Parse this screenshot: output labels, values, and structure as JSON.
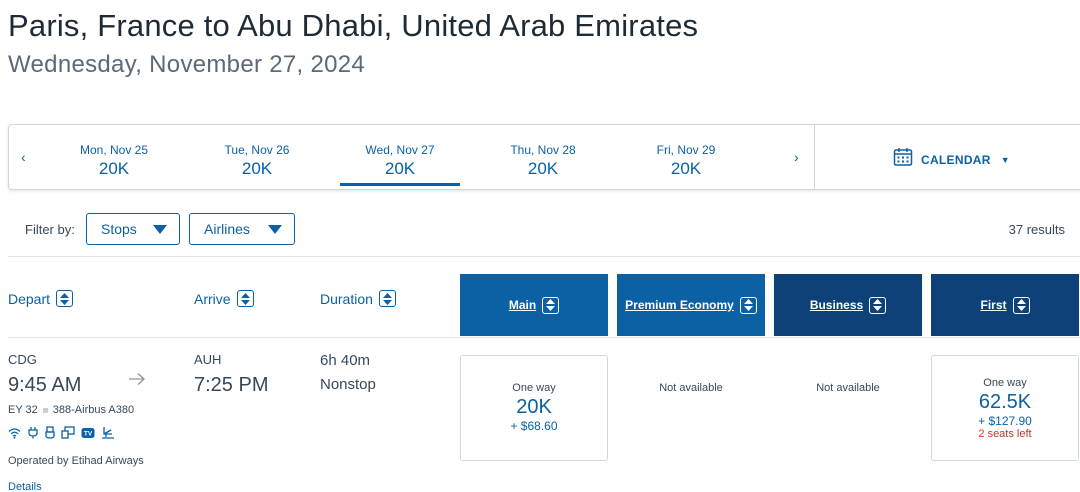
{
  "header": {
    "title": "Paris, France to Abu Dhabi, United Arab Emirates",
    "subtitle": "Wednesday, November 27, 2024"
  },
  "date_strip": {
    "prev_label": "‹",
    "next_label": "›",
    "days": [
      {
        "label": "Mon, Nov 25",
        "value": "20K",
        "selected": false
      },
      {
        "label": "Tue, Nov 26",
        "value": "20K",
        "selected": false
      },
      {
        "label": "Wed, Nov 27",
        "value": "20K",
        "selected": true
      },
      {
        "label": "Thu, Nov 28",
        "value": "20K",
        "selected": false
      },
      {
        "label": "Fri, Nov 29",
        "value": "20K",
        "selected": false
      }
    ],
    "calendar_label": "CALENDAR"
  },
  "filters": {
    "label": "Filter by:",
    "stops": "Stops",
    "airlines": "Airlines",
    "results": "37 results"
  },
  "columns": {
    "depart": "Depart",
    "arrive": "Arrive",
    "duration": "Duration",
    "cabins": [
      "Main",
      "Premium Economy",
      "Business",
      "First"
    ]
  },
  "flight": {
    "origin": "CDG",
    "depart_time": "9:45 AM",
    "destination": "AUH",
    "arrive_time": "7:25 PM",
    "duration": "6h 40m",
    "stops": "Nonstop",
    "flight_number": "EY 32",
    "aircraft": "388-Airbus A380",
    "operated_by": "Operated by Etihad Airways",
    "details_link": "Details",
    "amenities": [
      "wifi-icon",
      "power-icon",
      "usb-icon",
      "entertainment-icon",
      "tv-icon",
      "lie-flat-seat-icon"
    ],
    "fares": {
      "main": {
        "one_way": "One way",
        "points": "20K",
        "tax": "+ $68.60"
      },
      "premium_economy": {
        "status": "Not available"
      },
      "business": {
        "status": "Not available"
      },
      "first": {
        "one_way": "One way",
        "points": "62.5K",
        "tax": "+ $127.90",
        "seats": "2 seats left"
      }
    }
  },
  "colors": {
    "accent": "#0b61a4",
    "cabin_dark": "#0e4177",
    "warning": "#c0392b"
  }
}
